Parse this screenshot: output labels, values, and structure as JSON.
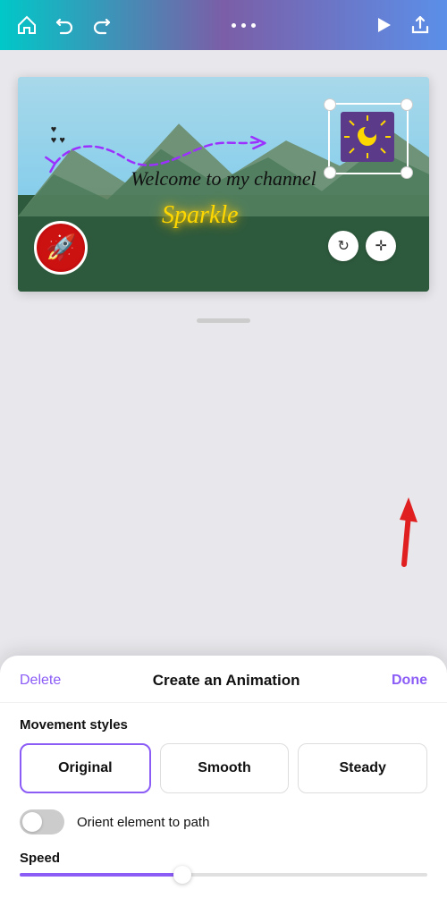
{
  "header": {
    "home_icon": "🏠",
    "undo_icon": "↩",
    "redo_icon": "↪",
    "play_icon": "▶",
    "share_icon": "⬆",
    "dots": [
      "•",
      "•",
      "•"
    ]
  },
  "canvas": {
    "welcome_text": "Welcome to my channel",
    "sparkle_text": "Sparkle",
    "sun_emoji": "🌟"
  },
  "sheet": {
    "delete_label": "Delete",
    "title_label": "Create an Animation",
    "done_label": "Done",
    "movement_label": "Movement styles",
    "buttons": [
      {
        "label": "Original",
        "active": true
      },
      {
        "label": "Smooth",
        "active": false
      },
      {
        "label": "Steady",
        "active": false
      }
    ],
    "orient_label": "Orient element to path",
    "speed_label": "Speed"
  }
}
